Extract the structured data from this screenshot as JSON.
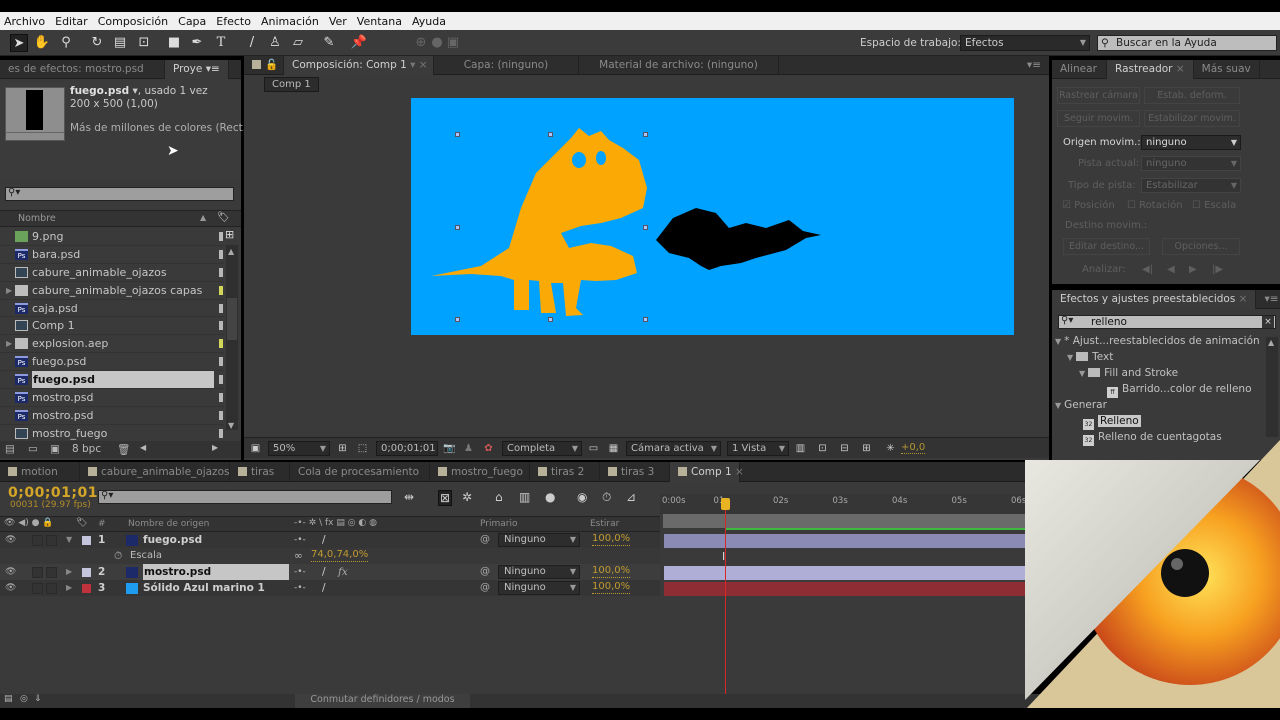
{
  "menu": [
    "Archivo",
    "Editar",
    "Composición",
    "Capa",
    "Efecto",
    "Animación",
    "Ver",
    "Ventana",
    "Ayuda"
  ],
  "toolbar": {
    "tools": [
      "selection-tool",
      "hand-tool",
      "zoom-tool",
      "rotate-tool",
      "camera-tool",
      "pan-behind-tool",
      "rectangle-tool",
      "pen-tool",
      "text-tool",
      "brush-tool",
      "clone-stamp-tool",
      "eraser-tool",
      "roto-brush-tool",
      "puppet-pin-tool"
    ],
    "workspace_label": "Espacio de trabajo:",
    "workspace_value": "Efectos",
    "help_placeholder": "Buscar en la Ayuda"
  },
  "project_panel": {
    "tabs": [
      "es de efectos: mostro.psd",
      "Proye"
    ],
    "selected_item": {
      "name": "fuego.psd",
      "usage": ", usado 1 vez",
      "dims": "200 x 500 (1,00)",
      "colors": "Más de millones de colores (Rect..."
    },
    "search_value": "",
    "column_header": "Nombre",
    "items": [
      {
        "name": "9.png",
        "type": "png",
        "label": "gray"
      },
      {
        "name": "bara.psd",
        "type": "ps",
        "label": "gray"
      },
      {
        "name": "cabure_animable_ojazos",
        "type": "comp",
        "label": "gray"
      },
      {
        "name": "cabure_animable_ojazos capas",
        "type": "folder",
        "label": "yellow"
      },
      {
        "name": "caja.psd",
        "type": "ps",
        "label": "gray"
      },
      {
        "name": "Comp 1",
        "type": "comp",
        "label": "gray"
      },
      {
        "name": "explosion.aep",
        "type": "folder",
        "label": "yellow"
      },
      {
        "name": "fuego.psd",
        "type": "ps",
        "label": "gray"
      },
      {
        "name": "fuego.psd",
        "type": "ps",
        "label": "gray",
        "selected": true
      },
      {
        "name": "mostro.psd",
        "type": "ps",
        "label": "gray"
      },
      {
        "name": "mostro.psd",
        "type": "ps",
        "label": "gray"
      },
      {
        "name": "mostro_fuego",
        "type": "comp",
        "label": "gray"
      }
    ],
    "bit_depth": "8 bpc"
  },
  "comp_panel": {
    "tabs": [
      "Composición: Comp 1",
      "Capa: (ninguno)",
      "Material de archivo: (ninguno)"
    ],
    "breadcrumb": "Comp 1",
    "background_color": "#00a2ff",
    "footer": {
      "zoom": "50%",
      "timecode": "0;00;01;01",
      "resolution": "Completa",
      "camera": "Cámara activa",
      "views": "1 Vista",
      "exposure": "+0,0"
    }
  },
  "tracker_panel": {
    "tabs": [
      "Alinear",
      "Rastreador",
      "Más suav"
    ],
    "buttons": [
      "Rastrear cámara",
      "Estab. deform.",
      "Seguir movim.",
      "Estabilizar movim."
    ],
    "motion_source_label": "Origen movim.:",
    "motion_source_value": "ninguno",
    "current_track_label": "Pista actual:",
    "current_track_value": "ninguno",
    "track_type_label": "Tipo de pista:",
    "track_type_value": "Estabilizar",
    "checks": [
      {
        "label": "Posición",
        "checked": true
      },
      {
        "label": "Rotación",
        "checked": false
      },
      {
        "label": "Escala",
        "checked": false
      }
    ],
    "target_label": "Destino movim.:",
    "edit_target": "Editar destino...",
    "options": "Opciones...",
    "analyze_label": "Analizar:"
  },
  "effects_panel": {
    "title": "Efectos y ajustes preestablecidos",
    "search_value": "relleno",
    "tree": [
      {
        "label": "* Ajust...reestablecidos de animación",
        "depth": 0,
        "kind": "group"
      },
      {
        "label": "Text",
        "depth": 1,
        "kind": "folder"
      },
      {
        "label": "Fill and Stroke",
        "depth": 2,
        "kind": "folder"
      },
      {
        "label": "Barrido...color de relleno",
        "depth": 3,
        "kind": "preset"
      },
      {
        "label": "Generar",
        "depth": 0,
        "kind": "group"
      },
      {
        "label": "Relleno",
        "depth": 1,
        "kind": "effect",
        "selected": true
      },
      {
        "label": "Relleno de cuentagotas",
        "depth": 1,
        "kind": "effect"
      }
    ]
  },
  "timeline": {
    "tabs": [
      "motion",
      "cabure_animable_ojazos",
      "tiras",
      "Cola de procesamiento",
      "mostro_fuego",
      "tiras 2",
      "tiras 3",
      "Comp 1"
    ],
    "active_tab": "Comp 1",
    "timecode": "0;00;01;01",
    "frame_info": "00031 (29.97 fps)",
    "columns": {
      "name": "Nombre de origen",
      "parent": "Primario",
      "stretch": "Estirar",
      "num": "#"
    },
    "layers": [
      {
        "num": "1",
        "name": "fuego.psd",
        "color": "#c4c4dc",
        "parent": "Ninguno",
        "stretch": "100,0%",
        "expanded": true,
        "fx": false
      },
      {
        "num": "2",
        "name": "mostro.psd",
        "color": "#c4c4dc",
        "parent": "Ninguno",
        "stretch": "100,0%",
        "expanded": false,
        "fx": true,
        "selected": true
      },
      {
        "num": "3",
        "name": "Sólido Azul marino 1",
        "color": "#c0323c",
        "parent": "Ninguno",
        "stretch": "100,0%",
        "expanded": false,
        "fx": false
      }
    ],
    "property": {
      "name": "Escala",
      "value": "74,0,74,0%"
    },
    "ruler": [
      "0:00s",
      "01s",
      "02s",
      "03s",
      "04s",
      "05s",
      "06s"
    ],
    "toggle_label": "Conmutar definidores / modos"
  }
}
